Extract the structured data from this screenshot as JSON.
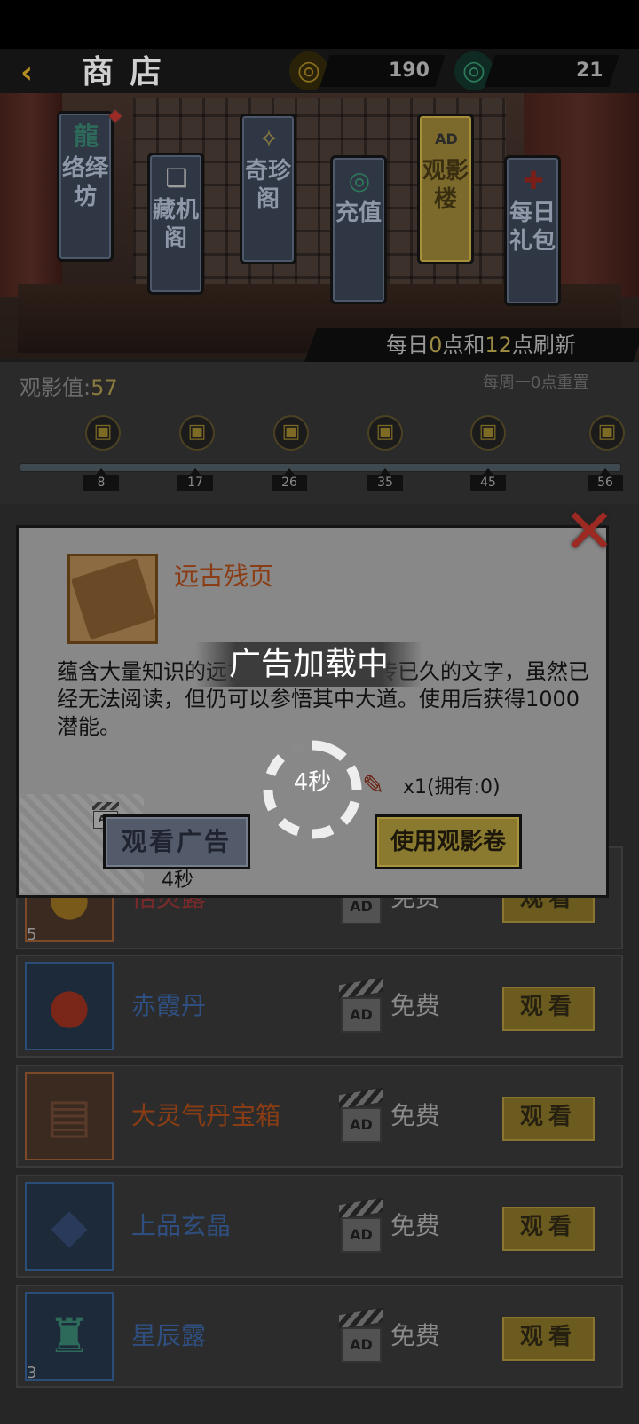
{
  "header": {
    "title": "商店",
    "currency_gold": "190",
    "currency_jade": "21",
    "back_icon": "back-arrow-icon"
  },
  "tabs": [
    {
      "label": "络绎坊",
      "icon": "jade-dragon-icon",
      "notify": true
    },
    {
      "label": "藏机阁",
      "icon": "scroll-icon"
    },
    {
      "label": "奇珍阁",
      "icon": "treasure-icon"
    },
    {
      "label": "充值",
      "icon": "jade-ring-icon"
    },
    {
      "label": "观影楼",
      "icon": "ad-clapper-icon",
      "active": true
    },
    {
      "label": "每日礼包",
      "icon": "gift-icon"
    }
  ],
  "refresh": {
    "pre": "每日",
    "h1": "0",
    "mid1": "点和",
    "h2": "12",
    "post": "点刷新"
  },
  "progress": {
    "label": "观影值:",
    "value": "57",
    "reset_note": "每周一0点重置",
    "milestones": [
      "8",
      "17",
      "26",
      "35",
      "45",
      "56"
    ]
  },
  "list": [
    {
      "name": "恬灵露",
      "count": "5",
      "free": "免费",
      "button": "观看",
      "name_color": "#7a2a2a",
      "icon": "gold-coin-icon"
    },
    {
      "name": "赤霞丹",
      "count": "",
      "free": "免费",
      "button": "观看",
      "name_color": "#2f4f80",
      "icon": "red-pill-icon"
    },
    {
      "name": "大灵气丹宝箱",
      "count": "",
      "free": "免费",
      "button": "观看",
      "name_color": "#8a3d14",
      "icon": "chest-icon"
    },
    {
      "name": "上品玄晶",
      "count": "",
      "free": "免费",
      "button": "观看",
      "name_color": "#2f4f80",
      "icon": "crystal-icon"
    },
    {
      "name": "星辰露",
      "count": "3",
      "free": "免费",
      "button": "观看",
      "name_color": "#2f4f80",
      "icon": "bronze-vessel-icon"
    }
  ],
  "ad_badge": "AD",
  "modal": {
    "item_name": "远古残页",
    "description": "蕴含大量知识的远古残页，使用失传已久的文字，虽然已经无法阅读，但仍可以参悟其中大道。使用后获得1000潜能。",
    "loading": "广告加载中",
    "spinner": "4秒",
    "ticket_count": "x1(拥有:0)",
    "watch_ad": "观看广告",
    "watch_ad_countdown": "4秒",
    "use_ticket": "使用观影卷",
    "close_icon": "close-x-icon",
    "item_icon": "ancient-page-icon"
  }
}
